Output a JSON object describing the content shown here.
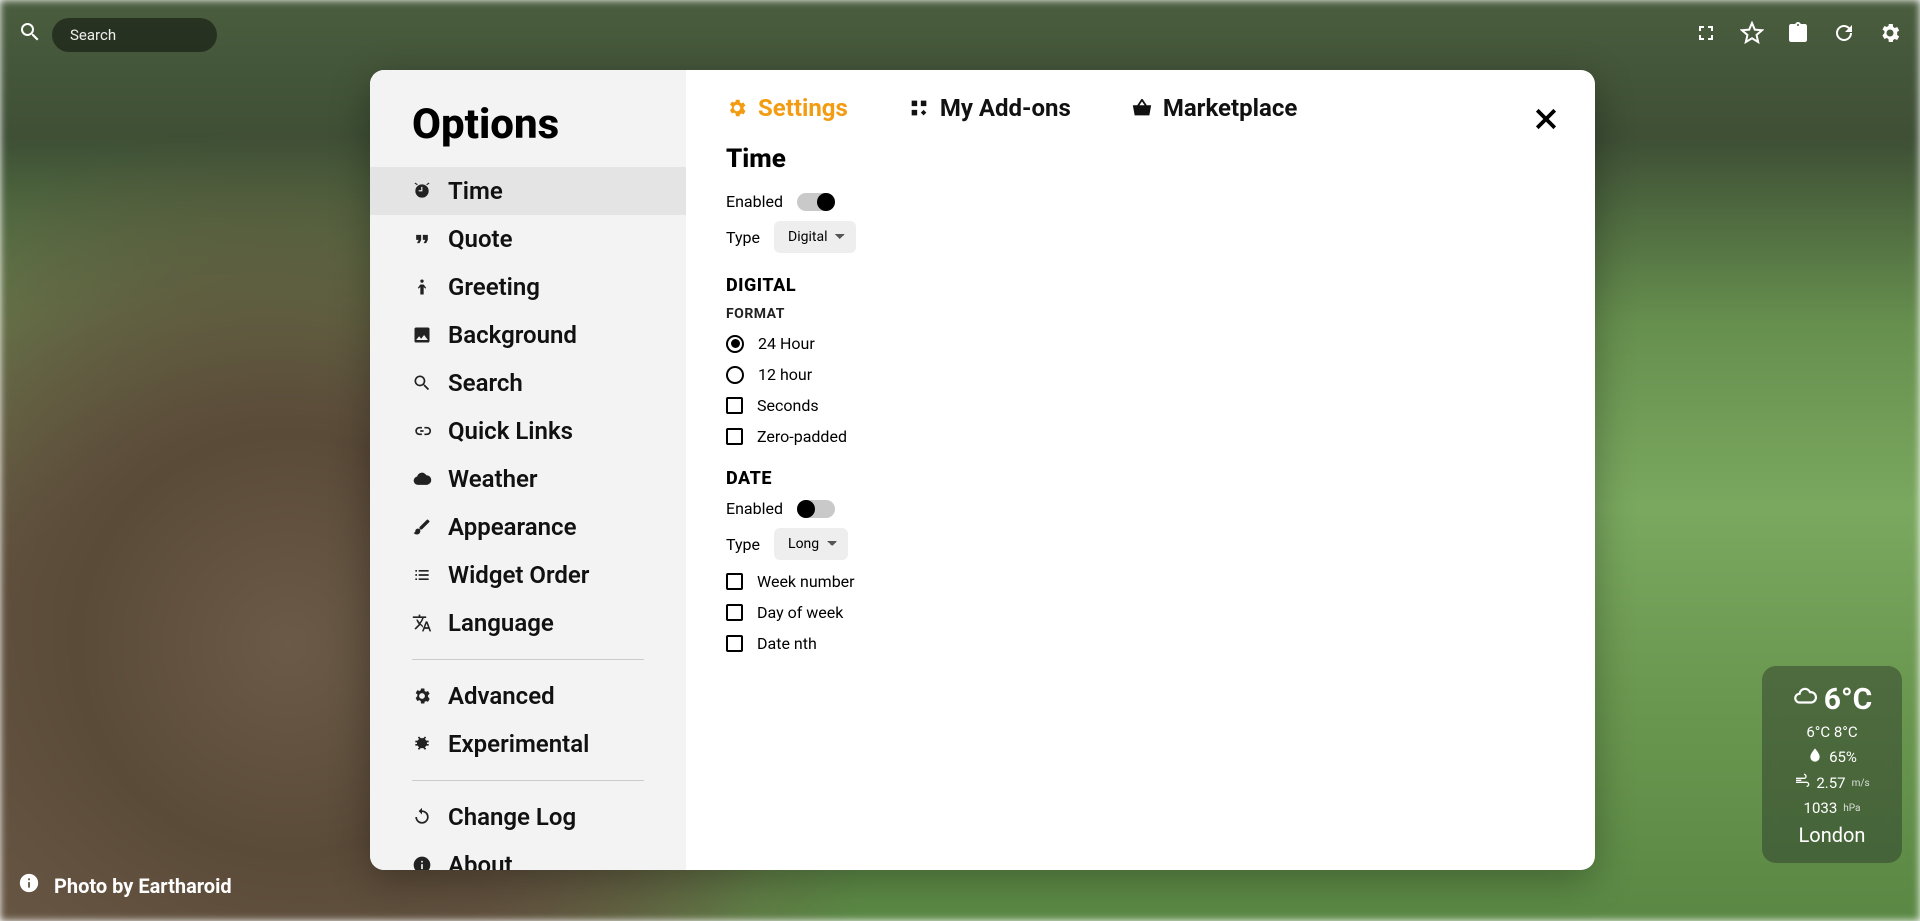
{
  "search": {
    "placeholder": "Search"
  },
  "credit": {
    "text": "Photo by Eartharoid"
  },
  "weather": {
    "temp": "6°C",
    "range": "6°C 8°C",
    "humidity": "65%",
    "wind": "2.57",
    "wind_unit": "m/s",
    "pressure": "1033",
    "pressure_unit": "hPa",
    "location": "London"
  },
  "sidebar": {
    "title": "Options",
    "items": [
      {
        "id": "time",
        "label": "Time"
      },
      {
        "id": "quote",
        "label": "Quote"
      },
      {
        "id": "greeting",
        "label": "Greeting"
      },
      {
        "id": "background",
        "label": "Background"
      },
      {
        "id": "search",
        "label": "Search"
      },
      {
        "id": "quicklinks",
        "label": "Quick Links"
      },
      {
        "id": "weather",
        "label": "Weather"
      },
      {
        "id": "appearance",
        "label": "Appearance"
      },
      {
        "id": "widgetorder",
        "label": "Widget Order"
      },
      {
        "id": "language",
        "label": "Language"
      },
      {
        "id": "advanced",
        "label": "Advanced"
      },
      {
        "id": "experimental",
        "label": "Experimental"
      },
      {
        "id": "changelog",
        "label": "Change Log"
      },
      {
        "id": "about",
        "label": "About"
      }
    ]
  },
  "tabs": {
    "settings": "Settings",
    "addons": "My Add-ons",
    "marketplace": "Marketplace"
  },
  "settings": {
    "time": {
      "title": "Time",
      "enabled_label": "Enabled",
      "enabled": true,
      "type_label": "Type",
      "type_value": "Digital",
      "digital": {
        "title": "DIGITAL",
        "format_label": "FORMAT",
        "opt_24": "24 Hour",
        "opt_12": "12 hour",
        "format_selected": "24",
        "seconds_label": "Seconds",
        "seconds": false,
        "zeropad_label": "Zero-padded",
        "zeropad": false
      },
      "date": {
        "title": "DATE",
        "enabled_label": "Enabled",
        "enabled": false,
        "type_label": "Type",
        "type_value": "Long",
        "weeknum_label": "Week number",
        "weeknum": false,
        "dayofweek_label": "Day of week",
        "dayofweek": false,
        "datenth_label": "Date nth",
        "datenth": false
      }
    }
  }
}
